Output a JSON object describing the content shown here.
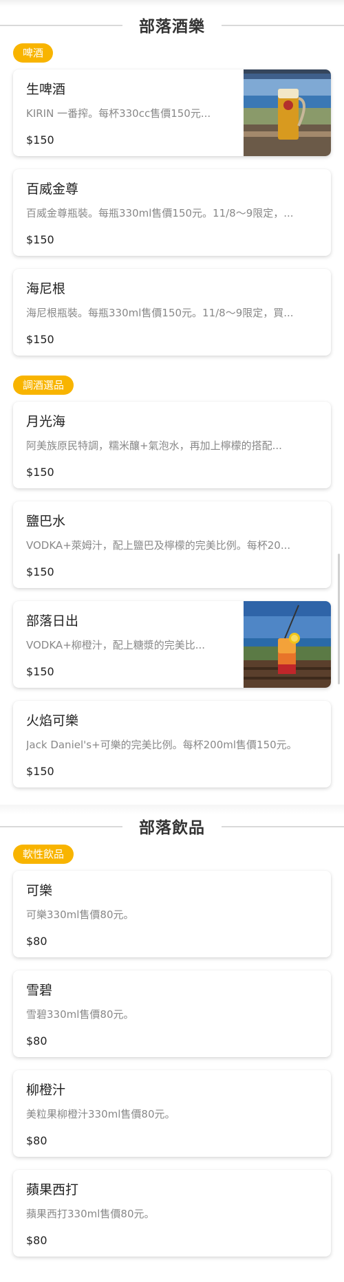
{
  "sections": [
    {
      "title": "部落酒樂",
      "groups": [
        {
          "badge": "啤酒",
          "items": [
            {
              "name": "生啤酒",
              "desc": "KIRIN 一番搾。每杯330cc售價150元...",
              "price": "$150",
              "image": "beer-photo"
            },
            {
              "name": "百威金尊",
              "desc": "百威金尊瓶裝。每瓶330ml售價150元。11/8～9限定，...",
              "price": "$150"
            },
            {
              "name": "海尼根",
              "desc": "海尼根瓶裝。每瓶330ml售價150元。11/8～9限定，買...",
              "price": "$150"
            }
          ]
        },
        {
          "badge": "調酒選品",
          "items": [
            {
              "name": "月光海",
              "desc": "阿美族原民特調，糯米釀+氣泡水，再加上檸檬的搭配...",
              "price": "$150"
            },
            {
              "name": "鹽巴水",
              "desc": "VODKA+萊姆汁，配上鹽巴及檸檬的完美比例。每杯20...",
              "price": "$150"
            },
            {
              "name": "部落日出",
              "desc": "VODKA+柳橙汁，配上糖漿的完美比...",
              "price": "$150",
              "image": "cocktail-photo"
            },
            {
              "name": "火焰可樂",
              "desc": "Jack Daniel's+可樂的完美比例。每杯200ml售價150元。",
              "price": "$150"
            }
          ]
        }
      ]
    },
    {
      "title": "部落飲品",
      "groups": [
        {
          "badge": "軟性飲品",
          "items": [
            {
              "name": "可樂",
              "desc": "可樂330ml售價80元。",
              "price": "$80"
            },
            {
              "name": "雪碧",
              "desc": "雪碧330ml售價80元。",
              "price": "$80"
            },
            {
              "name": "柳橙汁",
              "desc": "美粒果柳橙汁330ml售價80元。",
              "price": "$80"
            },
            {
              "name": "蘋果西打",
              "desc": "蘋果西打330ml售價80元。",
              "price": "$80"
            }
          ]
        }
      ]
    }
  ],
  "colors": {
    "badge": "#f8b400",
    "section_line": "#d9d9d9",
    "desc_text": "#888888"
  }
}
